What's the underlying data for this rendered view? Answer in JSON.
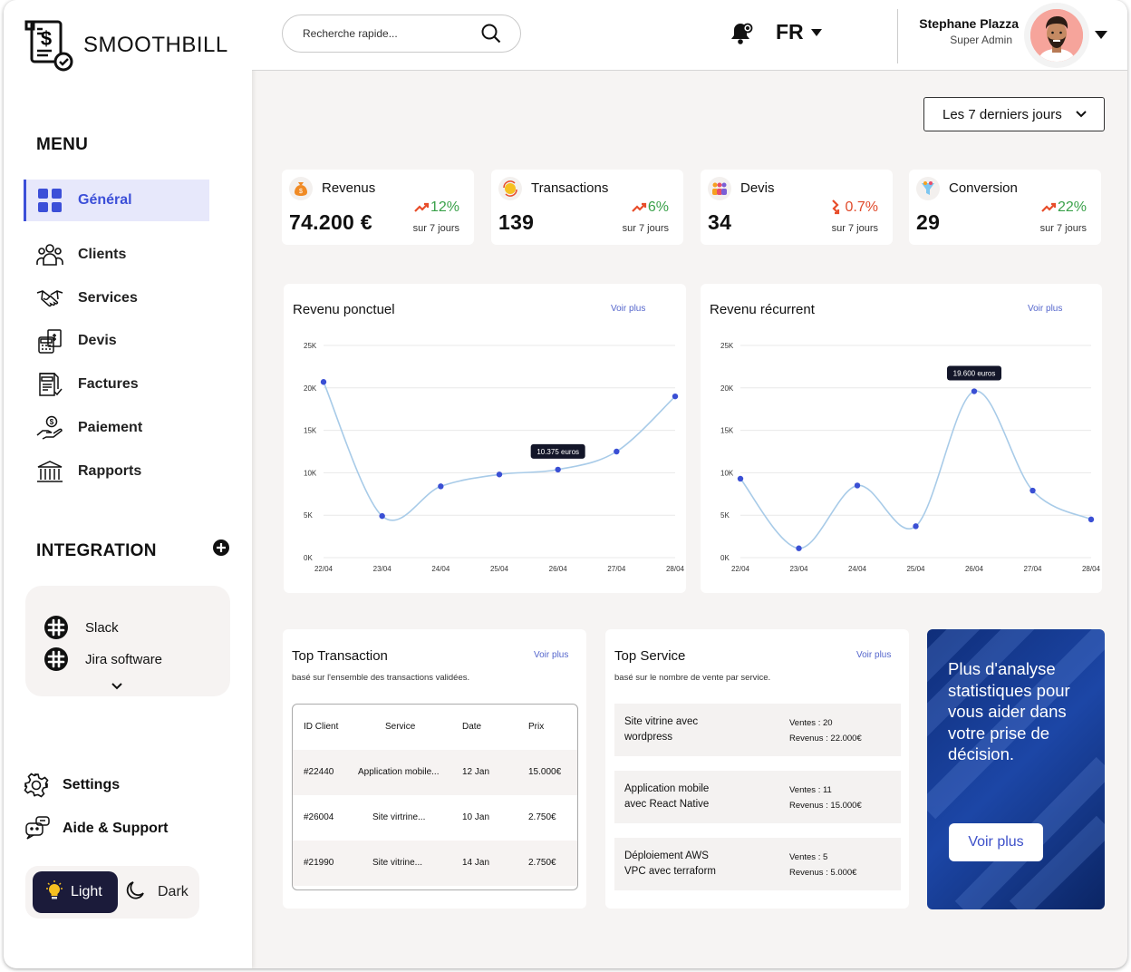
{
  "brand": {
    "name": "SMOOTHBILL"
  },
  "sidebar": {
    "menu_title": "MENU",
    "items": [
      {
        "label": "Général",
        "icon": "grid-icon",
        "active": true
      },
      {
        "label": "Clients",
        "icon": "users-icon"
      },
      {
        "label": "Services",
        "icon": "handshake-icon"
      },
      {
        "label": "Devis",
        "icon": "calculator-icon"
      },
      {
        "label": "Factures",
        "icon": "invoice-icon"
      },
      {
        "label": "Paiement",
        "icon": "payment-hand-icon"
      },
      {
        "label": "Rapports",
        "icon": "bank-icon"
      }
    ],
    "integration_title": "INTEGRATION",
    "integrations": [
      {
        "label": "Slack",
        "icon": "slack-icon"
      },
      {
        "label": "Jira software",
        "icon": "jira-icon"
      }
    ],
    "settings_label": "Settings",
    "support_label": "Aide & Support",
    "theme": {
      "light": "Light",
      "dark": "Dark",
      "selected": "Light"
    }
  },
  "header": {
    "search_placeholder": "Recherche rapide...",
    "language": "FR",
    "user_name": "Stephane Plazza",
    "user_role": "Super Admin"
  },
  "period": {
    "selected": "Les 7 derniers jours"
  },
  "stats": [
    {
      "title": "Revenus",
      "value": "74.200 €",
      "change": "12%",
      "trend": "up",
      "sub": "sur 7 jours",
      "icon": "money-bag-icon"
    },
    {
      "title": "Transactions",
      "value": "139",
      "change": "6%",
      "trend": "up",
      "sub": "sur 7 jours",
      "icon": "coin-exchange-icon"
    },
    {
      "title": "Devis",
      "value": "34",
      "change": "0.7%",
      "trend": "down",
      "sub": "sur 7 jours",
      "icon": "people-icon"
    },
    {
      "title": "Conversion",
      "value": "29",
      "change": "22%",
      "trend": "up",
      "sub": "sur 7 jours",
      "icon": "funnel-icon"
    }
  ],
  "colors": {
    "accent": "#3c4fd8",
    "up": "#3aa14a",
    "down": "#e04b2c",
    "line": "#a8cbe8",
    "point": "#3a4fd4"
  },
  "chart_data": [
    {
      "type": "line",
      "title": "Revenu  ponctuel",
      "more": "Voir plus",
      "x": [
        "22/04",
        "23/04",
        "24/04",
        "25/04",
        "26/04",
        "27/04",
        "28/04"
      ],
      "yticks": [
        "25K",
        "20K",
        "15K",
        "10K",
        "5K",
        "0K"
      ],
      "ylim": [
        0,
        25000
      ],
      "series": [
        {
          "values": [
            20700,
            4900,
            8400,
            9800,
            10375,
            12500,
            19000
          ]
        }
      ],
      "tooltip": {
        "index": 4,
        "text": "10.375 euros"
      }
    },
    {
      "type": "line",
      "title": "Revenu  récurrent",
      "more": "Voir plus",
      "x": [
        "22/04",
        "23/04",
        "24/04",
        "25/04",
        "26/04",
        "27/04",
        "28/04"
      ],
      "yticks": [
        "25K",
        "20K",
        "15K",
        "10K",
        "5K",
        "0K"
      ],
      "ylim": [
        0,
        25000
      ],
      "series": [
        {
          "values": [
            9300,
            1100,
            8500,
            3700,
            19600,
            7900,
            4500
          ]
        }
      ],
      "tooltip": {
        "index": 4,
        "text": "19.600 euros"
      }
    }
  ],
  "top_transaction": {
    "title": "Top Transaction",
    "more": "Voir plus",
    "subtitle": "basé sur l'ensemble des transactions validées.",
    "headers": [
      "ID Client",
      "Service",
      "Date",
      "Prix"
    ],
    "rows": [
      [
        "#22440",
        "Application mobile...",
        "12 Jan",
        "15.000€"
      ],
      [
        "#26004",
        "Site virtrine...",
        "10 Jan",
        "2.750€"
      ],
      [
        "#21990",
        "Site vitrine...",
        "14 Jan",
        "2.750€"
      ]
    ]
  },
  "top_service": {
    "title": "Top Service",
    "more": "Voir plus",
    "subtitle": "basé sur le nombre de vente par service.",
    "items": [
      {
        "name1": "Site vitrine avec",
        "name2": "wordpress",
        "sales": "Ventes : 20",
        "revenue": "Revenus : 22.000€"
      },
      {
        "name1": "Application mobile",
        "name2": "avec React Native",
        "sales": "Ventes : 11",
        "revenue": "Revenus : 15.000€"
      },
      {
        "name1": "Déploiement AWS",
        "name2": "VPC avec terraform",
        "sales": "Ventes : 5",
        "revenue": "Revenus : 5.000€"
      }
    ]
  },
  "promo": {
    "text": "Plus d'analyse statistiques pour vous aider dans votre prise de décision.",
    "button": "Voir plus"
  }
}
